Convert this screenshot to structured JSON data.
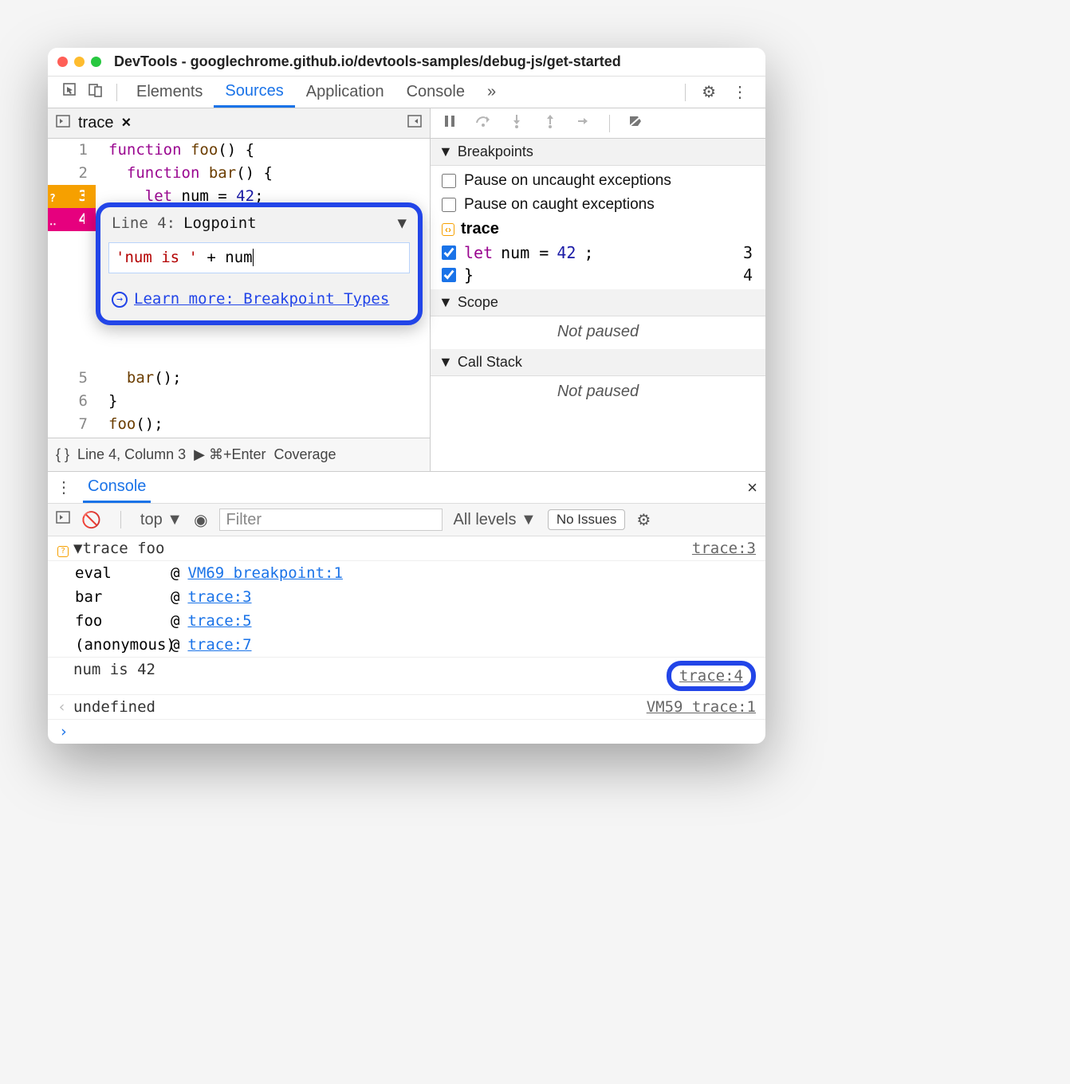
{
  "window": {
    "title": "DevTools - googlechrome.github.io/devtools-samples/debug-js/get-started"
  },
  "tabs": {
    "elements": "Elements",
    "sources": "Sources",
    "application": "Application",
    "console": "Console",
    "more": "»"
  },
  "source_header": {
    "filename": "trace",
    "close": "×"
  },
  "code": {
    "l1": {
      "n": "1",
      "t": "function foo() {"
    },
    "l2": {
      "n": "2",
      "t": "  function bar() {"
    },
    "l3": {
      "n": "3",
      "mark": "?",
      "t": "    let num = 42;"
    },
    "l4": {
      "n": "4",
      "mark": "‥",
      "t": "  }"
    },
    "l5": {
      "n": "5",
      "t": "  bar();"
    },
    "l6": {
      "n": "6",
      "t": "}"
    },
    "l7": {
      "n": "7",
      "t": "foo();"
    }
  },
  "popup": {
    "line_label": "Line 4:",
    "type": "Logpoint",
    "expr_str": "'num is '",
    "expr_rest": " + num",
    "learn": "Learn more: Breakpoint Types"
  },
  "source_footer": {
    "pretty": "{ }",
    "pos": "Line 4, Column 3",
    "run": "▶ ⌘+Enter",
    "cov": "Coverage"
  },
  "breakpoints": {
    "title": "Breakpoints",
    "uncaught": "Pause on uncaught exceptions",
    "caught": "Pause on caught exceptions",
    "file": "trace",
    "bp1": {
      "text": "let num = 42;",
      "line": "3"
    },
    "bp2": {
      "text": "}",
      "line": "4"
    }
  },
  "scope": {
    "title": "Scope",
    "body": "Not paused"
  },
  "callstack": {
    "title": "Call Stack",
    "body": "Not paused"
  },
  "console": {
    "tab": "Console",
    "top": "top",
    "filter_ph": "Filter",
    "levels": "All levels",
    "issues": "No Issues",
    "trace_hdr": "trace foo",
    "trace_loc": "trace:3",
    "stack": {
      "r1": {
        "fn": "eval",
        "at": "@",
        "loc": "VM69 breakpoint:1"
      },
      "r2": {
        "fn": "bar",
        "at": "@",
        "loc": "trace:3"
      },
      "r3": {
        "fn": "foo",
        "at": "@",
        "loc": "trace:5"
      },
      "r4": {
        "fn": "(anonymous)",
        "at": "@",
        "loc": "trace:7"
      }
    },
    "log": {
      "msg": "num is 42",
      "loc": "trace:4"
    },
    "undef": {
      "msg": "undefined",
      "loc": "VM59 trace:1"
    },
    "prompt": "›"
  }
}
